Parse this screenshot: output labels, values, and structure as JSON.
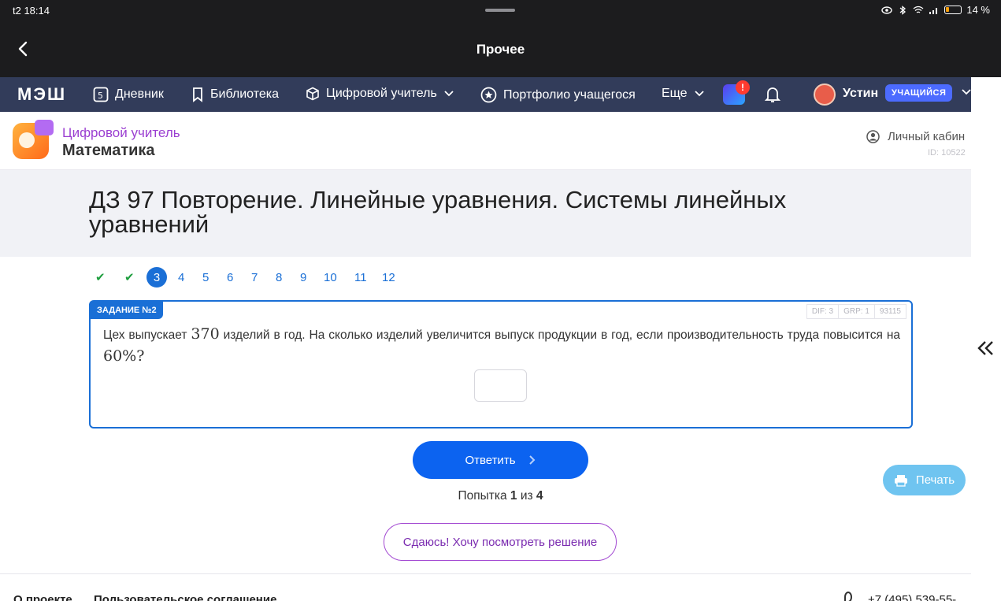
{
  "status_bar": {
    "time": "t2 18:14",
    "battery": "14 %"
  },
  "app_header": {
    "title": "Прочее"
  },
  "nav": {
    "logo": "МЭШ",
    "items": [
      {
        "label": "Дневник",
        "icon": "diary-icon"
      },
      {
        "label": "Библиотека",
        "icon": "bookmark-icon"
      },
      {
        "label": "Цифровой учитель",
        "icon": "cube-icon"
      },
      {
        "label": "Портфолио учащегося",
        "icon": "star-circle-icon"
      },
      {
        "label": "Еще",
        "icon": "chevron-down-icon"
      }
    ],
    "notification_badge": "!",
    "user_name": "Устин",
    "user_role": "УЧАЩИЙСЯ"
  },
  "subheader": {
    "brand_top": "Цифровой учитель",
    "brand_bottom": "Математика",
    "cabinet_label": "Личный кабин",
    "cabinet_id": "ID: 10522"
  },
  "page": {
    "title": "ДЗ 97 Повторение. Линейные уравнения. Системы линейных уравнений"
  },
  "pager": {
    "items": [
      {
        "label": "✔",
        "state": "done"
      },
      {
        "label": "✔",
        "state": "done"
      },
      {
        "label": "3",
        "state": "current"
      },
      {
        "label": "4",
        "state": "todo"
      },
      {
        "label": "5",
        "state": "todo"
      },
      {
        "label": "6",
        "state": "todo"
      },
      {
        "label": "7",
        "state": "todo"
      },
      {
        "label": "8",
        "state": "todo"
      },
      {
        "label": "9",
        "state": "todo"
      },
      {
        "label": "10",
        "state": "todo"
      },
      {
        "label": "11",
        "state": "todo"
      },
      {
        "label": "12",
        "state": "todo"
      }
    ]
  },
  "task": {
    "badge": "ЗАДАНИЕ №2",
    "meta": [
      "DIF: 3",
      "GRP: 1",
      "93115"
    ],
    "text_1": "Цех выпускает",
    "number_1": "370",
    "text_2": "изделий в год. На сколько изделий увеличится выпуск продукции в год, если производительность  труда повысится на",
    "number_2": "60%?",
    "answer_value": ""
  },
  "actions": {
    "submit_label": "Ответить",
    "attempt_prefix": "Попытка",
    "attempt_current": "1",
    "attempt_sep": "из",
    "attempt_total": "4",
    "giveup_label": "Сдаюсь! Хочу посмотреть решение",
    "print_label": "Печать"
  },
  "footer": {
    "about": "О проекте",
    "agreement": "Пользовательское соглашение",
    "phone": "+7 (495) 539-55-"
  },
  "colors": {
    "accent": "#1a6fd6",
    "nav_bg": "#323c5a",
    "purple": "#9b3fd1"
  }
}
